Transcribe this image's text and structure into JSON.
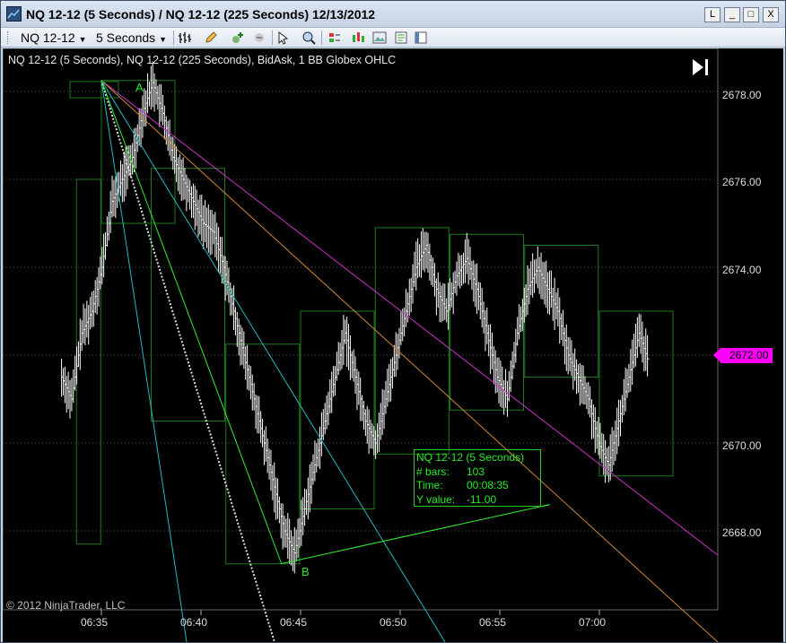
{
  "window": {
    "title": "NQ 12-12 (5 Seconds) / NQ 12-12 (225 Seconds)  12/13/2012",
    "buttons": {
      "restore": "L",
      "minimize": "_",
      "maximize": "□",
      "close": "X"
    }
  },
  "toolbar": {
    "instrument": "NQ 12-12",
    "interval": "5 Seconds",
    "icons": [
      "bar-type-icon",
      "pencil-draw-icon",
      "add-indicator-icon",
      "remove-icon",
      "cursor-icon",
      "zoom-icon",
      "strategy-icon",
      "chart-style-icon",
      "image-icon",
      "properties-icon"
    ]
  },
  "chart": {
    "label": "NQ 12-12 (5 Seconds), NQ 12-12 (225 Seconds), BidAsk, 1 BB Globex OHLC",
    "copyright": "© 2012 NinjaTrader, LLC",
    "current_price_label": "2672.00",
    "colors": {
      "background": "#000000",
      "bars": "#ffffff",
      "boxes": "#1e7a1e",
      "grid": "#555555",
      "price_marker": "#ff00ff",
      "line_magenta": "#cc33cc",
      "line_orange": "#cc8833",
      "line_cyan": "#22bbbb",
      "line_green": "#33ee33"
    },
    "point_labels": {
      "a": "A",
      "b": "B"
    },
    "ruler": {
      "title": "NQ 12-12 (5 Seconds)",
      "bars_label": "# bars:",
      "bars_value": "103",
      "time_label": "Time:",
      "time_value": "00:08:35",
      "y_label": "Y value:",
      "y_value": "-11.00"
    }
  },
  "chart_data": {
    "type": "ohlc",
    "title": "NQ 12-12 (5 Seconds), NQ 12-12 (225 Seconds), BidAsk, 1 BB Globex OHLC",
    "y_ticks": [
      "2678.00",
      "2676.00",
      "2674.00",
      "2672.00",
      "2670.00",
      "2668.00"
    ],
    "x_ticks": [
      "06:35",
      "06:40",
      "06:45",
      "06:50",
      "06:55",
      "07:00"
    ],
    "ylim": [
      2666.4,
      2679.7
    ],
    "boxes_225s": [
      {
        "start": "06:33:45",
        "open_high": 2676.0,
        "low": 2667.7,
        "high": 2676.0
      },
      {
        "start": "06:35:00",
        "low": 2675.0,
        "high": 2678.25
      },
      {
        "start": "06:37:30",
        "low": 2670.5,
        "high": 2676.25
      },
      {
        "start": "06:41:15",
        "low": 2667.25,
        "high": 2672.25
      },
      {
        "start": "06:45:00",
        "low": 2668.5,
        "high": 2673.0
      },
      {
        "start": "06:48:45",
        "low": 2669.75,
        "high": 2674.9
      },
      {
        "start": "06:52:30",
        "low": 2670.75,
        "high": 2674.75
      },
      {
        "start": "06:56:15",
        "low": 2671.5,
        "high": 2674.5
      },
      {
        "start": "07:00:00",
        "low": 2669.25,
        "high": 2673.0
      }
    ],
    "series": [
      {
        "name": "NQ 12-12 (5 Seconds)",
        "close_path": [
          2671.5,
          2671.0,
          2672.5,
          2673.0,
          2674.0,
          2675.5,
          2676.0,
          2676.5,
          2677.5,
          2678.2,
          2677.5,
          2676.5,
          2676.0,
          2675.5,
          2675.0,
          2674.8,
          2674.0,
          2673.0,
          2672.0,
          2671.0,
          2670.0,
          2669.0,
          2668.0,
          2667.5,
          2668.5,
          2669.5,
          2670.5,
          2671.5,
          2672.5,
          2671.5,
          2670.5,
          2670.0,
          2671.0,
          2672.0,
          2673.0,
          2674.0,
          2674.5,
          2673.5,
          2673.0,
          2673.8,
          2674.2,
          2673.5,
          2672.5,
          2671.5,
          2671.0,
          2672.5,
          2673.5,
          2674.0,
          2673.5,
          2673.0,
          2672.0,
          2671.5,
          2671.0,
          2670.0,
          2669.5,
          2670.5,
          2671.5,
          2672.5,
          2671.8
        ]
      }
    ],
    "drawings": {
      "point_a": {
        "time": "06:35",
        "price": 2678.25
      },
      "point_b": {
        "time": "06:44",
        "price": 2667.25
      },
      "ruler_end": {
        "time": "06:57:30",
        "price": 2668.6
      }
    }
  }
}
